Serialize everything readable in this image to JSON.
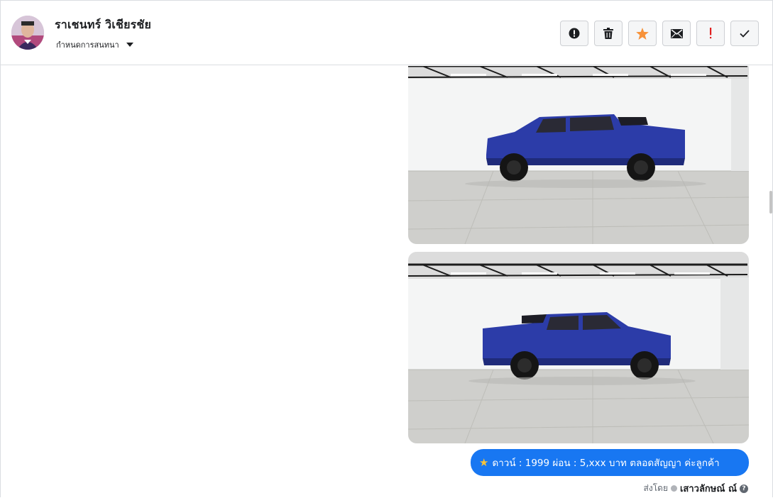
{
  "header": {
    "name": "ราเชนทร์ วิเชียรชัย",
    "subtitle": "กำหนดการสนทนา"
  },
  "toolbar": {
    "buttons": [
      {
        "icon": "alert-circle-icon"
      },
      {
        "icon": "trash-icon"
      },
      {
        "icon": "star-icon",
        "color": "#f7923a"
      },
      {
        "icon": "mail-icon"
      },
      {
        "icon": "exclamation-icon",
        "color": "#e02020"
      },
      {
        "icon": "check-icon"
      }
    ]
  },
  "message": {
    "text": "ดาวน์ : 1999  ผ่อน : 5,xxx บาท ตลอดสัญญา ค่ะลูกค้า",
    "bubble_color": "#1877f2"
  },
  "footer": {
    "sent_by_label": "ส่งโดย",
    "sender": "เสาวลักษณ์ ณ์",
    "help": "?"
  }
}
